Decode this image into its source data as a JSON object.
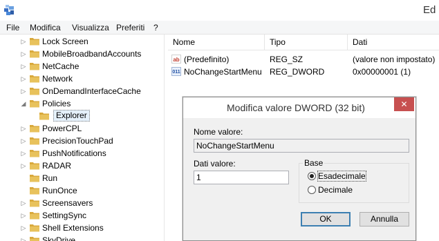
{
  "window": {
    "title": "Ed"
  },
  "menu": {
    "items": [
      {
        "label": "File"
      },
      {
        "label": "Modifica"
      },
      {
        "label": "Visualizza"
      },
      {
        "label": "Preferiti"
      },
      {
        "label": "?"
      }
    ]
  },
  "tree": {
    "items": [
      {
        "label": "Lock Screen",
        "expander": "▷"
      },
      {
        "label": "MobileBroadbandAccounts",
        "expander": "▷"
      },
      {
        "label": "NetCache",
        "expander": "▷"
      },
      {
        "label": "Network",
        "expander": "▷"
      },
      {
        "label": "OnDemandInterfaceCache",
        "expander": "▷"
      },
      {
        "label": "Policies",
        "expander": "◢"
      },
      {
        "label": "Explorer",
        "expander": ""
      },
      {
        "label": "PowerCPL",
        "expander": "▷"
      },
      {
        "label": "PrecisionTouchPad",
        "expander": "▷"
      },
      {
        "label": "PushNotifications",
        "expander": "▷"
      },
      {
        "label": "RADAR",
        "expander": "▷"
      },
      {
        "label": "Run",
        "expander": ""
      },
      {
        "label": "RunOnce",
        "expander": ""
      },
      {
        "label": "Screensavers",
        "expander": "▷"
      },
      {
        "label": "SettingSync",
        "expander": "▷"
      },
      {
        "label": "Shell Extensions",
        "expander": "▷"
      },
      {
        "label": "SkyDrive",
        "expander": "▷"
      }
    ]
  },
  "list": {
    "columns": [
      "Nome",
      "Tipo",
      "Dati"
    ],
    "rows": [
      {
        "icon": "ab",
        "name": "(Predefinito)",
        "type": "REG_SZ",
        "data": "(valore non impostato)"
      },
      {
        "icon": "011",
        "name": "NoChangeStartMenu",
        "type": "REG_DWORD",
        "data": "0x00000001 (1)"
      }
    ]
  },
  "dialog": {
    "title": "Modifica valore DWORD (32 bit)",
    "close": "✕",
    "name_label": "Nome valore:",
    "name_value": "NoChangeStartMenu",
    "data_label": "Dati valore:",
    "data_value": "1",
    "base_label": "Base",
    "radio_hex": "Esadecimale",
    "radio_dec": "Decimale",
    "ok": "OK",
    "cancel": "Annulla"
  },
  "colors": {
    "folder": "#e8c25c",
    "close": "#c75050",
    "selection": "#e5f1fb"
  }
}
